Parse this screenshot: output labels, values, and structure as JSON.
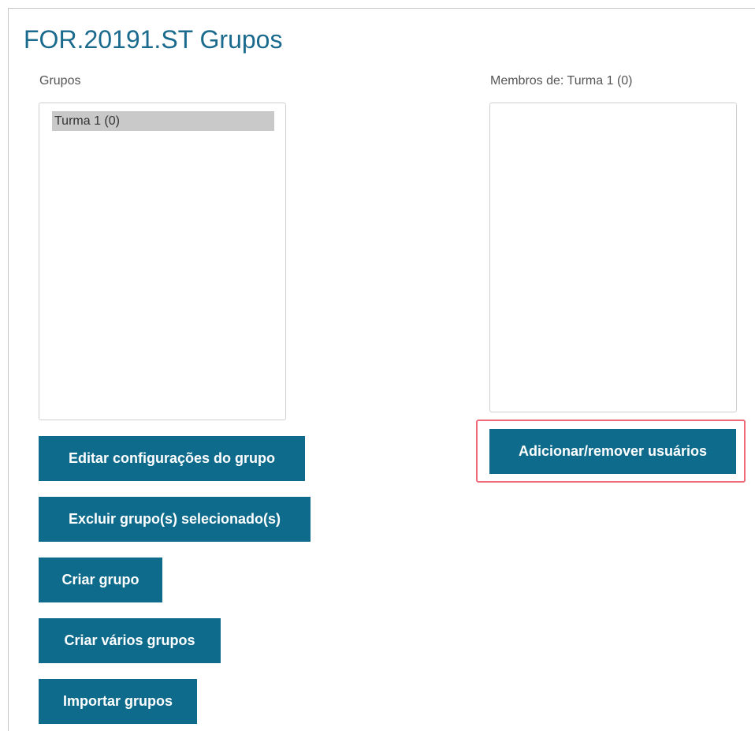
{
  "page": {
    "title": "FOR.20191.ST Grupos"
  },
  "groups_panel": {
    "label": "Grupos",
    "items": [
      {
        "label": "Turma 1 (0)",
        "selected": true
      }
    ]
  },
  "members_panel": {
    "label": "Membros de: Turma 1 (0)",
    "items": []
  },
  "buttons": {
    "edit_group_settings": "Editar configurações do grupo",
    "delete_selected_groups": "Excluir grupo(s) selecionado(s)",
    "create_group": "Criar grupo",
    "create_multiple_groups": "Criar vários grupos",
    "import_groups": "Importar grupos",
    "add_remove_users": "Adicionar/remover usuários"
  },
  "colors": {
    "title": "#1a6a8e",
    "button_bg": "#0e6b8b",
    "selected_option_bg": "#c9c9c9",
    "highlight_border": "#f06a7a"
  }
}
